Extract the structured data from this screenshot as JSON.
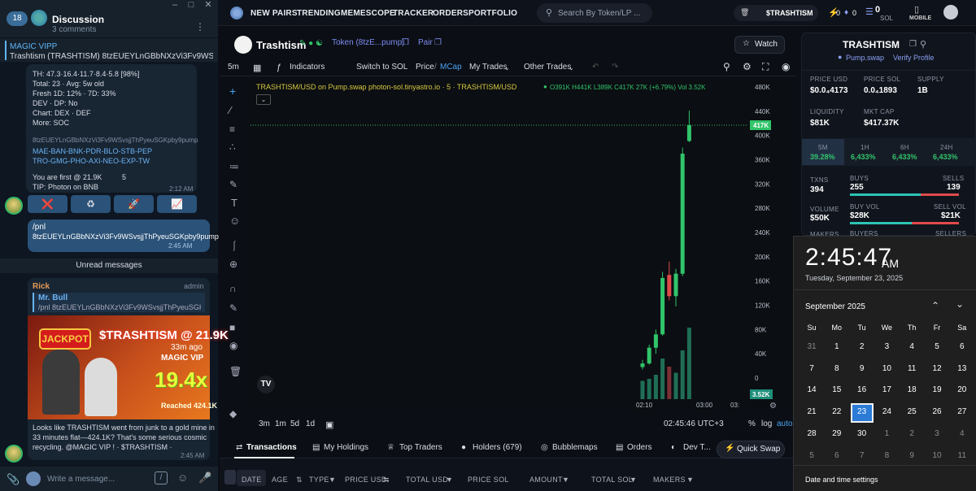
{
  "telegram": {
    "unread_count": "18",
    "title": "Discussion",
    "subtitle": "3 comments",
    "pinned_title": "MAGIC VIPP",
    "pinned_text": "Trashtism (TRASHTISM) 8tzEUEYLnGBbNXzVi3Fv9WSvsjjThPye...",
    "bot_lines": [
      "TH: 47.3·16.4·11.7·8.4·5.8 [98%]",
      "Total: 23 · Avg: 5w old",
      "Fresh 1D: 12% · 7D: 33%",
      "DEV · DP: No",
      "Chart: DEX · DEF",
      "More: SOC"
    ],
    "bot_address": "8tzEUEYLnGBbNXzVi3Fv9WSvsjjThPyeuSGKpby9pump",
    "bot_links1": "MAE-BAN-BNK-PDR-BLO-STB-PEP",
    "bot_links2": "TRO-GMG-PHO-AXI-NEO-EXP-TW",
    "bot_first": "You are first @ 21.9K",
    "bot_first_count": "5",
    "bot_tip": "TIP: Photon on BNB",
    "bot_time": "2:12 AM",
    "action_buttons": [
      "❌",
      "♻",
      "🚀",
      "📈"
    ],
    "own_msg1": "/pnl",
    "own_msg2": "8tzEUEYLnGBbNXzVi3Fv9WSvsjjThPyeuSGKpby9pump",
    "own_time": "2:45 AM",
    "unread_label": "Unread messages",
    "msg_author": "Rick",
    "msg_role": "admin",
    "reply_name": "Mr. Bull",
    "reply_text": "/pnl 8tzEUEYLnGBbNXzVi3Fv9WSvsjjThPyeuSGKpb...",
    "img_jackpot": "JACKPOT",
    "img_title": "$TRASHTISM @ 21.9K",
    "img_ago": "33m ago",
    "img_vip": "MAGIC VIP",
    "img_mult": "19.4x",
    "img_reached": "Reached 424.1K",
    "msg_lines": [
      "Looks like TRASHTISM went from junk to a gold mine in",
      "33 minutes flat—424.1K? That's some serious cosmic",
      "recycling. @MAGIC VIP ! · $TRASHTISM ·"
    ],
    "msg_time": "2:45 AM",
    "input_placeholder": "Write a message..."
  },
  "nav": {
    "items": [
      "NEW PAIRS",
      "TRENDING",
      "MEMESCOPE",
      "TRACKER",
      "ORDERS",
      "PORTFOLIO"
    ],
    "search_placeholder": "Search By Token/LP ...",
    "wallet_token": "$TRASHTISM",
    "badge1": "0",
    "badge2": "0",
    "sol_balance": "0",
    "sol_label": "SOL",
    "mobile_label": "MOBILE"
  },
  "token": {
    "name": "Trashtism",
    "token_btn": "Token (8tzE...pump)",
    "pair_btn": "Pair",
    "watch_label": "Watch"
  },
  "chart_toolbar": {
    "interval": "5m",
    "indicators": "Indicators",
    "switch": "Switch to SOL",
    "price": "Price",
    "mcap": "MCap",
    "my_trades": "My Trades",
    "other_trades": "Other Trades"
  },
  "chart_data": {
    "type": "candlestick",
    "title": "TRASHTISM/USD on Pump.swap photon-sol.tinyastro.io · 5 · TRASHTISM/USD",
    "ohlc_text": "O391K H441K L389K C417K 27K (+6.79%) Vol 3.52K",
    "y_ticks": [
      "480K",
      "440K",
      "400K",
      "360K",
      "320K",
      "280K",
      "240K",
      "200K",
      "160K",
      "120K",
      "80K",
      "40K",
      "0"
    ],
    "ylim": [
      0,
      480
    ],
    "x_ticks": [
      "02:10",
      "03:00",
      "03:"
    ],
    "price_label": "417K",
    "volume_label": "3.52K",
    "candles": [
      {
        "o": 18,
        "h": 30,
        "l": 14,
        "c": 24,
        "v": 0.9
      },
      {
        "o": 24,
        "h": 55,
        "l": 22,
        "c": 50,
        "v": 1.0
      },
      {
        "o": 50,
        "h": 80,
        "l": 40,
        "c": 72,
        "v": 1.2
      },
      {
        "o": 72,
        "h": 175,
        "l": 70,
        "c": 165,
        "v": 2.0
      },
      {
        "o": 170,
        "h": 192,
        "l": 128,
        "c": 135,
        "v": 1.6
      },
      {
        "o": 135,
        "h": 180,
        "l": 118,
        "c": 172,
        "v": 1.3
      },
      {
        "o": 172,
        "h": 380,
        "l": 168,
        "c": 370,
        "v": 2.4
      },
      {
        "o": 391,
        "h": 441,
        "l": 389,
        "c": 417,
        "v": 3.52
      }
    ]
  },
  "chart_bottom": {
    "ranges": [
      "3m",
      "1m",
      "5d",
      "1d"
    ],
    "time": "02:45:46 UTC+3",
    "pct": "%",
    "log": "log",
    "auto": "auto"
  },
  "tabs": {
    "items": [
      "Transactions",
      "My Holdings",
      "Top Traders",
      "Holders (679)",
      "Bubblemaps",
      "Orders",
      "Dev T..."
    ],
    "quick_swap": "Quick Swap",
    "headers": [
      "DATE",
      "AGE",
      "TYPE",
      "PRICE USD",
      "TOTAL USD",
      "PRICE SOL",
      "AMOUNT",
      "TOTAL SOL",
      "MAKERS"
    ]
  },
  "right_panel": {
    "name": "TRASHTISM",
    "exchange": "Pump.swap",
    "verify": "Verify Profile",
    "price_usd_label": "PRICE USD",
    "price_usd": "$0.0₄4173",
    "price_sol_label": "PRICE SOL",
    "price_sol": "0.0₄1893",
    "supply_label": "SUPPLY",
    "supply": "1B",
    "liquidity_label": "LIQUIDITY",
    "liquidity": "$81K",
    "mcap_label": "MKT CAP",
    "mcap": "$417.37K",
    "periods": [
      {
        "label": "5M",
        "value": "39.28%"
      },
      {
        "label": "1H",
        "value": "6,433%"
      },
      {
        "label": "6H",
        "value": "6,433%"
      },
      {
        "label": "24H",
        "value": "6,433%"
      }
    ],
    "txns_label": "TXNS",
    "txns": "394",
    "buys_label": "BUYS",
    "buys": "255",
    "sells_label": "SELLS",
    "sells": "139",
    "buys_ratio": 0.647,
    "volume_label": "VOLUME",
    "volume": "$50K",
    "buy_vol_label": "BUY VOL",
    "buy_vol": "$28K",
    "sell_vol_label": "SELL VOL",
    "sell_vol": "$21K",
    "vol_ratio": 0.57,
    "makers_label": "MAKERS",
    "buyers_label": "BUYERS",
    "sellers_label": "SELLERS"
  },
  "calendar": {
    "time": "2:45:47",
    "ampm": "AM",
    "date": "Tuesday, September 23, 2025",
    "month": "September 2025",
    "weekdays": [
      "Su",
      "Mo",
      "Tu",
      "We",
      "Th",
      "Fr",
      "Sa"
    ],
    "days": [
      [
        "31",
        "1",
        "2",
        "3",
        "4",
        "5",
        "6"
      ],
      [
        "7",
        "8",
        "9",
        "10",
        "11",
        "12",
        "13"
      ],
      [
        "14",
        "15",
        "16",
        "17",
        "18",
        "19",
        "20"
      ],
      [
        "21",
        "22",
        "23",
        "24",
        "25",
        "26",
        "27"
      ],
      [
        "28",
        "29",
        "30",
        "1",
        "2",
        "3",
        "4"
      ],
      [
        "5",
        "6",
        "7",
        "8",
        "9",
        "10",
        "11"
      ]
    ],
    "settings": "Date and time settings"
  }
}
